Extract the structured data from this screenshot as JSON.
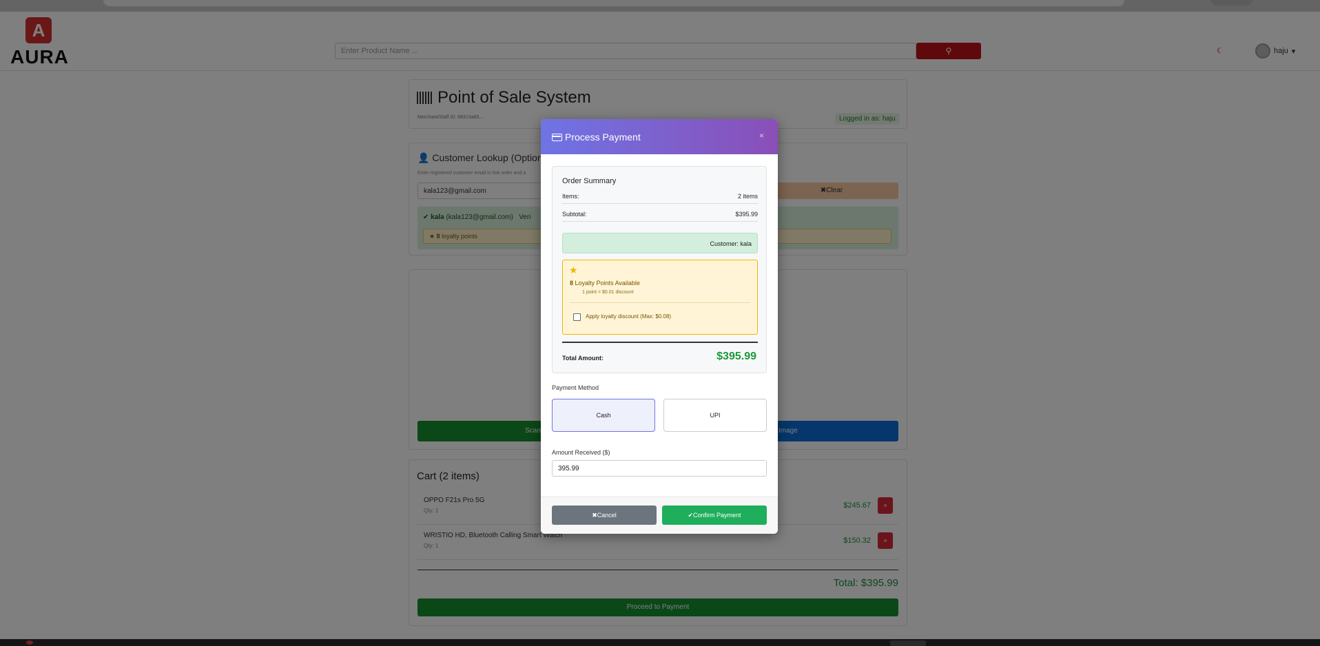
{
  "header": {
    "logo_text": "AURA",
    "search_placeholder": "Enter Product Name ...",
    "search_icon": "search-icon",
    "user_name": "haju"
  },
  "pos": {
    "title": "Point of Sale System",
    "staff_id": "Merchant/Staff ID: 68313a65...",
    "logged_in": "Logged in as: haju",
    "customer_lookup_title": "Customer Lookup (Optional)",
    "customer_lookup_sub": "Enter registered customer email to link order and a",
    "customer_email": "kala123@gmail.com",
    "clear_label": "Clear",
    "customer_name": "kala",
    "customer_email_paren": "(kala123@gmail.com)",
    "verified_label": "Veri",
    "loyalty_points_count": "8",
    "loyalty_points_label": "loyalty points",
    "scan_left_label": "Scan Ba",
    "scan_right_label": "rcode Image"
  },
  "cart": {
    "title": "Cart (2 items)",
    "items": [
      {
        "name": "OPPO F21s Pro 5G",
        "qty": "Qty: 1",
        "price": "$245.67"
      },
      {
        "name": "WRISTIO HD, Bluetooth Calling Smart Watch",
        "qty": "Qty: 1",
        "price": "$150.32"
      }
    ],
    "total": "Total: $395.99",
    "proceed_label": "Proceed to Payment"
  },
  "modal": {
    "title": "Process Payment",
    "close": "×",
    "summary_title": "Order Summary",
    "items_label": "Items:",
    "items_value": "2 items",
    "subtotal_label": "Subtotal:",
    "subtotal_value": "$395.99",
    "customer_chip": "Customer: kala",
    "loyalty_points": "8",
    "loyalty_available": "Loyalty Points Available",
    "loyalty_rate": "1 point = $0.01 discount",
    "apply_loyalty": "Apply loyalty discount (Max: $0.08)",
    "total_label": "Total Amount:",
    "total_value": "$395.99",
    "payment_method_label": "Payment Method",
    "methods": [
      "Cash",
      "UPI"
    ],
    "selected_method": "Cash",
    "amount_received_label": "Amount Received ($)",
    "amount_received_value": "395.99",
    "cancel_label": "Cancel",
    "confirm_label": "Confirm Payment"
  },
  "colors": {
    "brand_red": "#c0121a",
    "modal_gradient_start": "#6f74e4",
    "modal_gradient_end": "#8a4fb8",
    "success_green": "#1a9a3a",
    "loyalty_border": "#f0b400"
  }
}
